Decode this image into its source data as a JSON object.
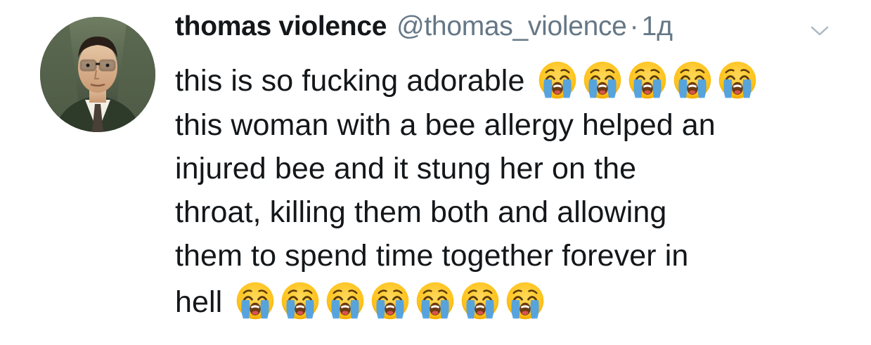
{
  "tweet": {
    "display_name": "thomas violence",
    "handle": "@thomas_violence",
    "separator": "·",
    "time": "1д",
    "lines": [
      "this is so fucking adorable",
      "this woman with a bee allergy helped an",
      "injured bee and it stung her on the",
      "throat, killing them both and allowing",
      "them to spend time together forever in",
      "hell"
    ],
    "line1_emoji": [
      "loudly-crying-face-emoji",
      "loudly-crying-face-emoji",
      "loudly-crying-face-emoji",
      "loudly-crying-face-emoji",
      "loudly-crying-face-emoji"
    ],
    "last_line_emoji": [
      "loudly-crying-face-emoji",
      "loudly-crying-face-emoji",
      "loudly-crying-face-emoji",
      "loudly-crying-face-emoji",
      "loudly-crying-face-emoji",
      "loudly-crying-face-emoji",
      "loudly-crying-face-emoji"
    ]
  },
  "colors": {
    "text": "#14171a",
    "secondary": "#657786",
    "caret": "#aab8c2",
    "emoji_face": "#ffc83d",
    "emoji_tears": "#4ea1e6"
  },
  "icons": {
    "caret": "chevron-down-icon",
    "avatar": "avatar"
  }
}
